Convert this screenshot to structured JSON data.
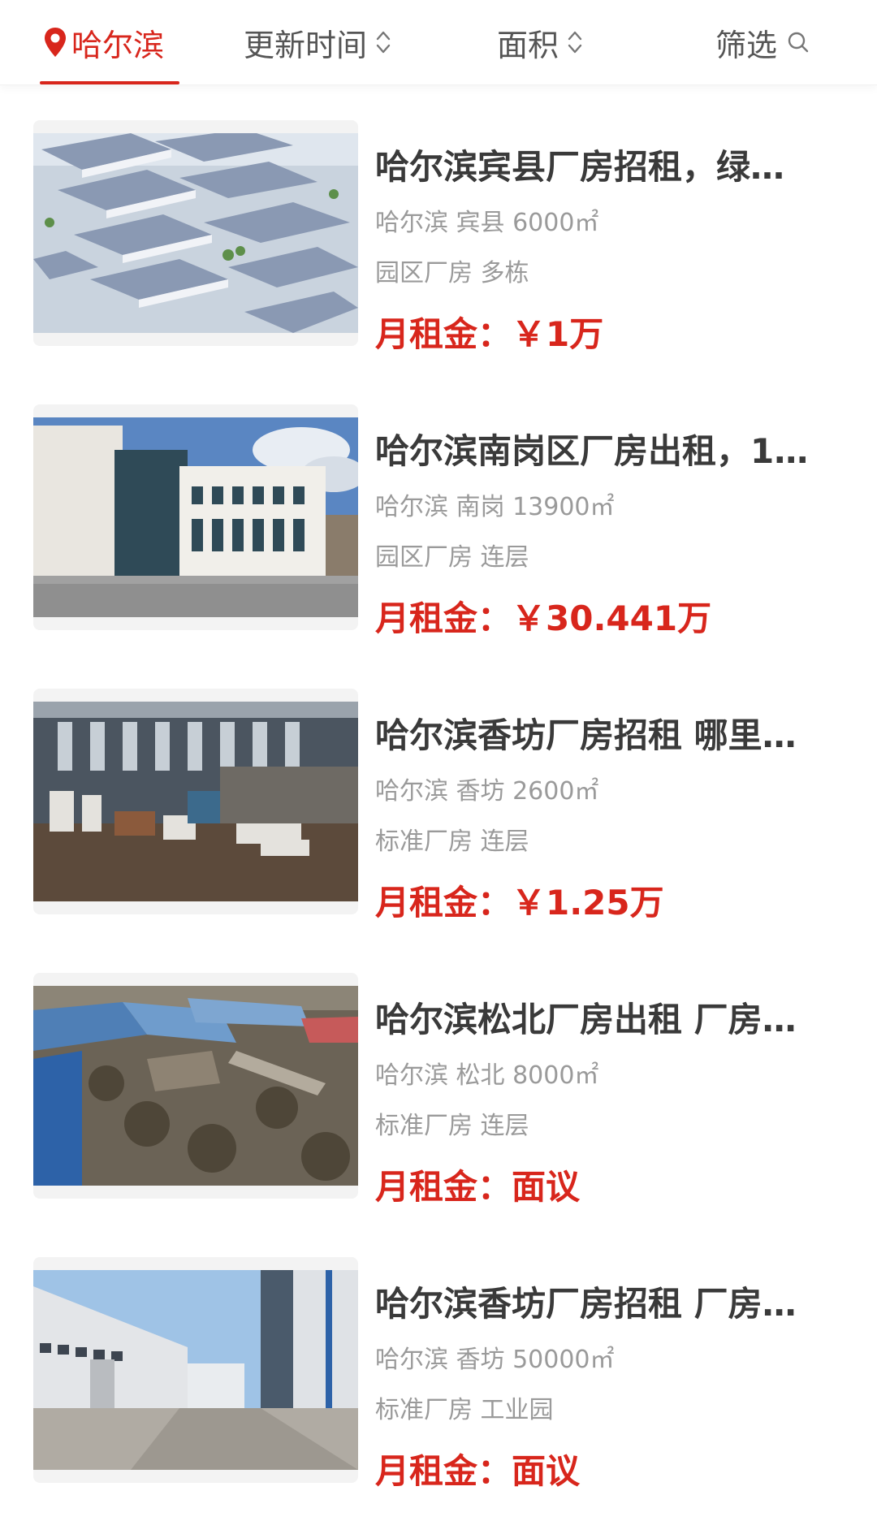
{
  "filter_bar": {
    "city": "哈尔滨",
    "sort_update": "更新时间",
    "sort_area": "面积",
    "filter": "筛选"
  },
  "listings": [
    {
      "title": "哈尔滨宾县厂房招租，绿…",
      "location": "哈尔滨 宾县 6000㎡",
      "type": "园区厂房 多栋",
      "price": "月租金：￥1万",
      "image": "aerial-industrial-park-render"
    },
    {
      "title": "哈尔滨南岗区厂房出租，1…",
      "location": "哈尔滨 南岗 13900㎡",
      "type": "园区厂房 连层",
      "price": "月租金：￥30.441万",
      "image": "white-office-building-street"
    },
    {
      "title": "哈尔滨香坊厂房招租 哪里…",
      "location": "哈尔滨 香坊 2600㎡",
      "type": "标准厂房 连层",
      "price": "月租金：￥1.25万",
      "image": "factory-interior-workshop"
    },
    {
      "title": "哈尔滨松北厂房出租 厂房…",
      "location": "哈尔滨 松北 8000㎡",
      "type": "标准厂房 连层",
      "price": "月租金：面议",
      "image": "aerial-blue-roof-factory"
    },
    {
      "title": "哈尔滨香坊厂房招租 厂房…",
      "location": "哈尔滨 香坊 50000㎡",
      "type": "标准厂房 工业园",
      "price": "月租金：面议",
      "image": "warehouse-street-view"
    }
  ],
  "colors": {
    "accent": "#d8261c",
    "title": "#3a3a3a",
    "meta": "#9a9a9a"
  }
}
